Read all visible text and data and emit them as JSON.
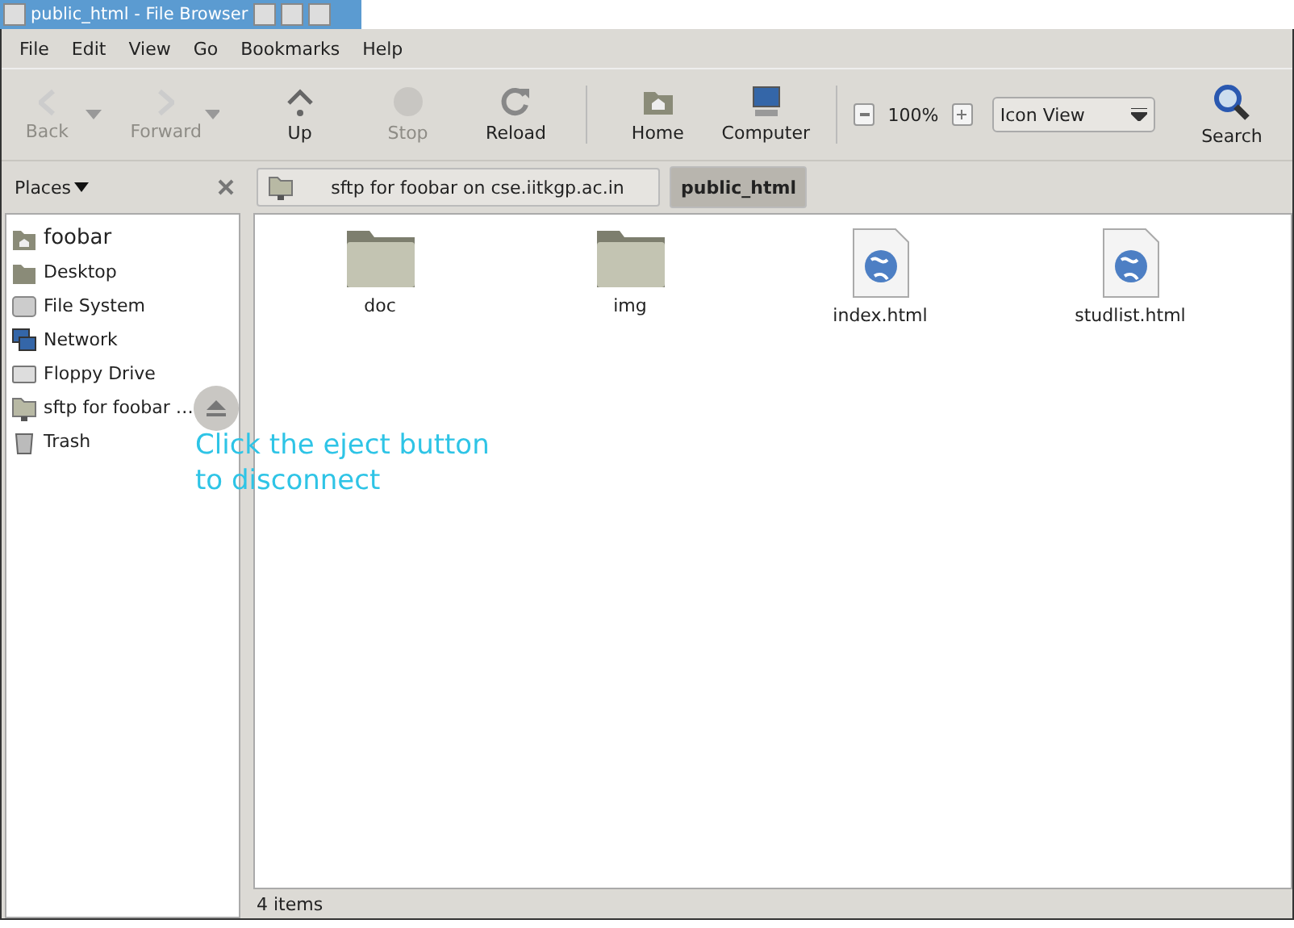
{
  "window": {
    "title": "public_html - File Browser"
  },
  "menu": [
    "File",
    "Edit",
    "View",
    "Go",
    "Bookmarks",
    "Help"
  ],
  "toolbar": [
    {
      "kind": "back",
      "label": "Back",
      "disabled": true
    },
    {
      "kind": "forward",
      "label": "Forward",
      "disabled": true
    },
    {
      "kind": "up",
      "label": "Up",
      "disabled": false
    },
    {
      "kind": "stop",
      "label": "Stop",
      "disabled": true
    },
    {
      "kind": "reload",
      "label": "Reload",
      "disabled": false
    },
    {
      "kind": "separator"
    },
    {
      "kind": "home",
      "label": "Home",
      "disabled": false
    },
    {
      "kind": "computer",
      "label": "Computer",
      "disabled": false
    },
    {
      "kind": "separator"
    },
    {
      "kind": "zoom",
      "label": "100%"
    },
    {
      "kind": "select",
      "label": "Icon View"
    },
    {
      "kind": "search",
      "label": "Search",
      "disabled": false
    }
  ],
  "sidebar": {
    "title": "Places",
    "items": [
      {
        "label": "foobar",
        "kind": "home",
        "eject": false
      },
      {
        "label": "Desktop",
        "kind": "desktop",
        "eject": false
      },
      {
        "label": "File System",
        "kind": "disk",
        "eject": false
      },
      {
        "label": "Network",
        "kind": "network",
        "eject": false
      },
      {
        "label": "Floppy Drive",
        "kind": "floppy",
        "eject": false
      },
      {
        "label": "sftp for foobar …",
        "kind": "remote",
        "eject": true
      },
      {
        "label": "Trash",
        "kind": "trash",
        "eject": false
      }
    ]
  },
  "pathbar": [
    {
      "label": "sftp for foobar on cse.iitkgp.ac.in",
      "selected": false,
      "kind": "remote"
    },
    {
      "label": "public_html",
      "selected": true,
      "kind": "folder"
    }
  ],
  "files": [
    {
      "name": "doc",
      "kind": "folder"
    },
    {
      "name": "img",
      "kind": "folder"
    },
    {
      "name": "index.html",
      "kind": "html"
    },
    {
      "name": "studlist.html",
      "kind": "html"
    }
  ],
  "annotation": "Click the eject button to disconnect",
  "status_bar": "4 items"
}
